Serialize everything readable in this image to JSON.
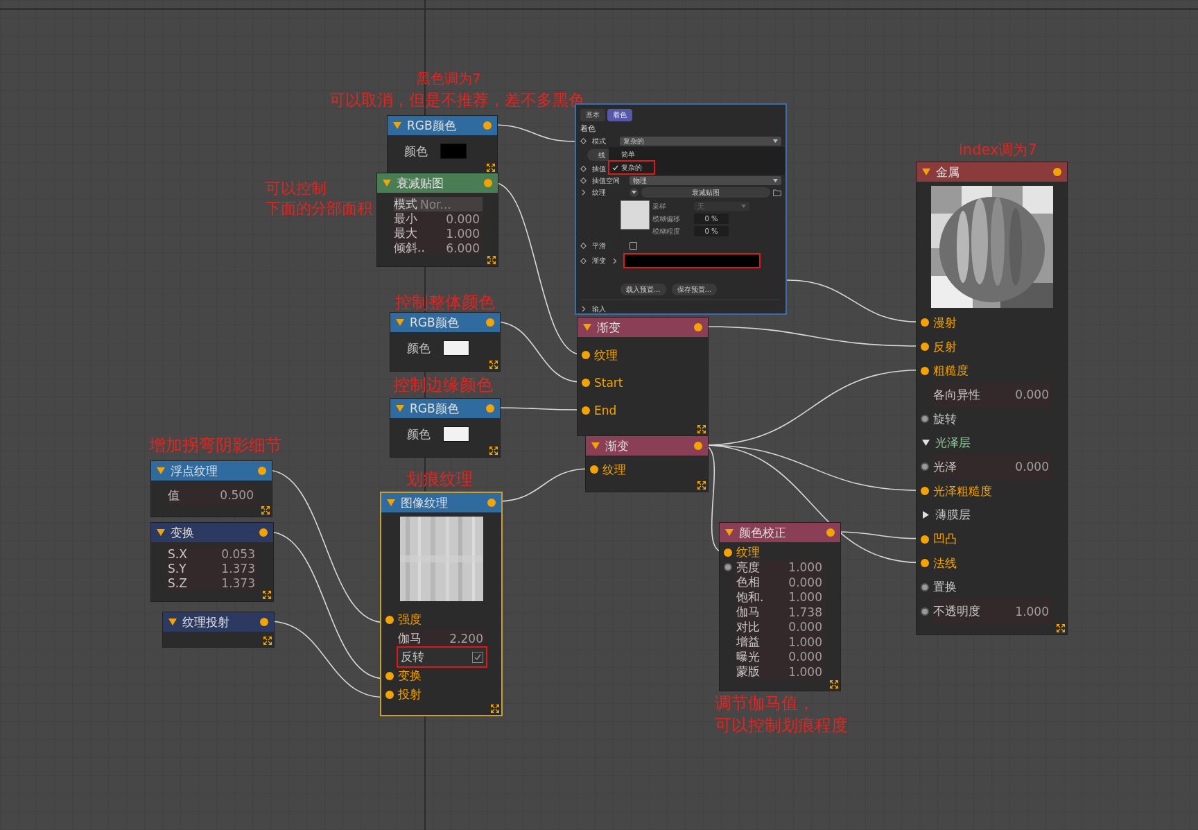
{
  "annotations": [
    {
      "lines": [
        "黑色调为7"
      ]
    },
    {
      "lines": [
        "可以取消，但是不推荐，差不多黑色"
      ]
    },
    {
      "lines": [
        "index调为7"
      ]
    },
    {
      "lines": [
        "可以控制",
        "下面的分部面积"
      ]
    },
    {
      "lines": [
        "控制整体颜色"
      ]
    },
    {
      "lines": [
        "控制边缘颜色"
      ]
    },
    {
      "lines": [
        "增加拐弯阴影细节"
      ]
    },
    {
      "lines": [
        "划痕纹理"
      ]
    },
    {
      "lines": [
        "调节伽马值，",
        "可以控制划痕程度"
      ]
    }
  ],
  "nodes": [
    {
      "title": "RGB颜色",
      "color": "#2f6b9e",
      "selected": false,
      "rows": [
        {
          "kind": "swatch",
          "label": "颜色",
          "color": "#000000"
        }
      ]
    },
    {
      "title": "衰减贴图",
      "color": "#4b7d55",
      "selected": false,
      "rows": [
        {
          "kind": "dropdown",
          "label": "模式",
          "value": "Nor..."
        },
        {
          "kind": "value",
          "label": "最小",
          "value": "0.000"
        },
        {
          "kind": "value",
          "label": "最大",
          "value": "1.000"
        },
        {
          "kind": "value",
          "label": "倾斜..",
          "value": "6.000"
        }
      ]
    },
    {
      "title": "RGB颜色",
      "color": "#2f6b9e",
      "selected": false,
      "rows": [
        {
          "kind": "swatch",
          "label": "颜色",
          "color": "#f2f2f2"
        }
      ]
    },
    {
      "title": "RGB颜色",
      "color": "#2f6b9e",
      "selected": false,
      "rows": [
        {
          "kind": "swatch",
          "label": "颜色",
          "color": "#f2f2f2"
        }
      ]
    },
    {
      "title": "浮点纹理",
      "color": "#2f6b9e",
      "selected": false,
      "rows": [
        {
          "kind": "value",
          "label": "值",
          "value": "0.500"
        }
      ]
    },
    {
      "title": "变换",
      "color": "#2c3a62",
      "selected": false,
      "rows": [
        {
          "kind": "value",
          "label": "S.X",
          "value": "0.053"
        },
        {
          "kind": "value",
          "label": "S.Y",
          "value": "1.373"
        },
        {
          "kind": "value",
          "label": "S.Z",
          "value": "1.373"
        }
      ]
    },
    {
      "title": "纹理投射",
      "color": "#2c3a62",
      "selected": false
    },
    {
      "title": "图像纹理",
      "color": "#2f6b9e",
      "selected": true,
      "rows": [
        {
          "kind": "input",
          "label": "强度",
          "linked": true
        },
        {
          "kind": "value",
          "label": "伽马",
          "value": "2.200"
        },
        {
          "kind": "checkbox",
          "label": "反转",
          "checked": true,
          "highlighted": true
        },
        {
          "kind": "input",
          "label": "变换",
          "linked": true
        },
        {
          "kind": "input",
          "label": "投射",
          "linked": true
        }
      ]
    },
    {
      "title": "渐变",
      "color": "#8a3f57",
      "selected": false,
      "rows": [
        {
          "kind": "input",
          "label": "纹理",
          "linked": true
        },
        {
          "kind": "input",
          "label": "Start",
          "linked": true
        },
        {
          "kind": "input",
          "label": "End",
          "linked": true
        }
      ]
    },
    {
      "title": "渐变",
      "color": "#8a3f57",
      "selected": false,
      "rows": [
        {
          "kind": "input",
          "label": "纹理",
          "linked": true
        }
      ]
    },
    {
      "title": "颜色校正",
      "color": "#8a3f57",
      "selected": false,
      "rows": [
        {
          "kind": "input",
          "label": "纹理",
          "linked": true
        },
        {
          "kind": "value",
          "label": "亮度",
          "value": "1.000",
          "linked": false
        },
        {
          "kind": "value",
          "label": "色相",
          "value": "0.000"
        },
        {
          "kind": "value",
          "label": "饱和.",
          "value": "1.000"
        },
        {
          "kind": "value",
          "label": "伽马",
          "value": "1.738"
        },
        {
          "kind": "value",
          "label": "对比",
          "value": "0.000"
        },
        {
          "kind": "value",
          "label": "增益",
          "value": "1.000"
        },
        {
          "kind": "value",
          "label": "曝光",
          "value": "0.000"
        },
        {
          "kind": "value",
          "label": "蒙版",
          "value": "1.000"
        }
      ]
    },
    {
      "title": "金属",
      "color": "#8b3b3b",
      "selected": false,
      "rows": [
        {
          "kind": "input",
          "label": "漫射",
          "linked": true
        },
        {
          "kind": "input",
          "label": "反射",
          "linked": true
        },
        {
          "kind": "input",
          "label": "粗糙度",
          "linked": true
        },
        {
          "kind": "value",
          "label": "各向异性",
          "value": "0.000"
        },
        {
          "kind": "input",
          "label": "旋转",
          "linked": false
        },
        {
          "kind": "section",
          "label": "光泽层",
          "expanded": true
        },
        {
          "kind": "value",
          "label": "光泽",
          "value": "0.000",
          "linked": false
        },
        {
          "kind": "input",
          "label": "光泽粗糙度",
          "linked": true
        },
        {
          "kind": "section",
          "label": "薄膜层",
          "expanded": false
        },
        {
          "kind": "input",
          "label": "凹凸",
          "linked": true
        },
        {
          "kind": "input",
          "label": "法线",
          "linked": true
        },
        {
          "kind": "input",
          "label": "置换",
          "linked": false
        },
        {
          "kind": "value",
          "label": "不透明度",
          "value": "1.000",
          "linked": false
        }
      ]
    }
  ],
  "settings_panel": {
    "tabs": [
      {
        "label": "基本",
        "selected": false
      },
      {
        "label": "着色",
        "selected": true
      }
    ],
    "section": "着色",
    "mode": {
      "label": "模式",
      "value": "复杂的"
    },
    "mode_menu": [
      {
        "label": "简单",
        "selected": false,
        "highlighted": false
      },
      {
        "label": "复杂的",
        "selected": true,
        "highlighted": true
      }
    ],
    "line_button": "线",
    "interpolation_label": "插值",
    "interpolation_space": {
      "label": "插值空间",
      "value": "物理"
    },
    "texture": {
      "label": "纹理",
      "value": "衰减贴图"
    },
    "sampling": {
      "label": "采样",
      "value": "无",
      "disabled": true
    },
    "blur_offset": {
      "label": "模糊偏移",
      "value": "0 %"
    },
    "blur_amount": {
      "label": "模糊程度",
      "value": "0 %"
    },
    "smooth": {
      "label": "平滑",
      "checked": false
    },
    "gradient": {
      "label": "渐变",
      "color": "#000000",
      "highlighted": true
    },
    "buttons": [
      "载入预置...",
      "保存预置..."
    ],
    "inputs": {
      "label": "输入",
      "expanded": false
    }
  }
}
